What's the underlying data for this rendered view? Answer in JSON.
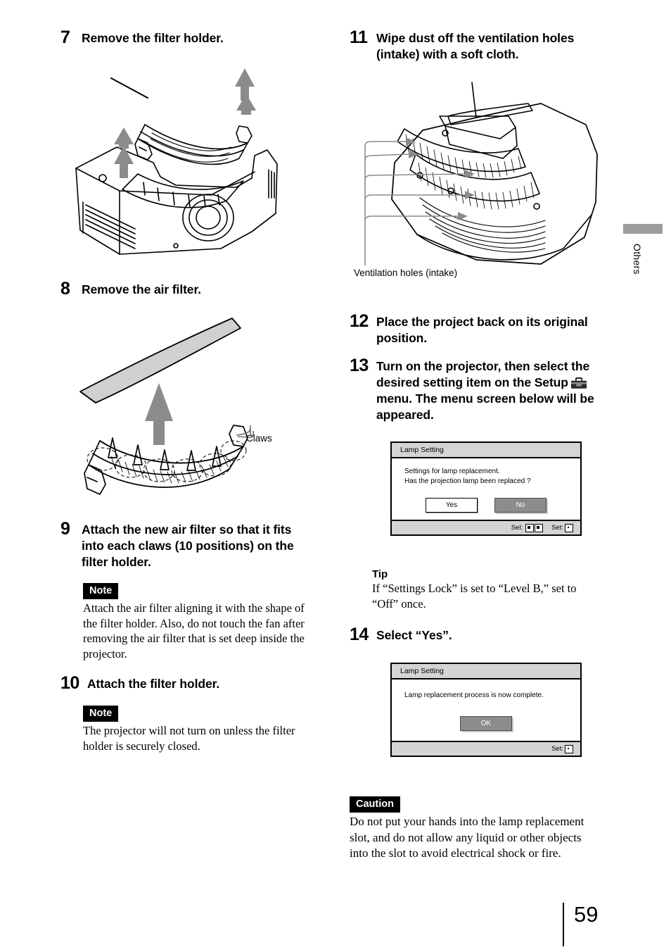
{
  "page": {
    "number": "59",
    "side_tab_label": "Others"
  },
  "left_column": {
    "step7": {
      "number": "7",
      "title": "Remove the filter holder."
    },
    "step8": {
      "number": "8",
      "title": "Remove the air filter.",
      "callout_label": "Claws"
    },
    "step9": {
      "number": "9",
      "title": "Attach the new air filter so that it fits into each claws (10 positions) on the filter holder.",
      "note_label": "Note",
      "note_text": "Attach the air filter aligning it with the shape of the filter holder. Also, do not touch the fan after removing the air filter that is set deep inside the projector."
    },
    "step10": {
      "number": "10",
      "title": "Attach the filter holder.",
      "note_label": "Note",
      "note_text": "The projector will not turn on unless the filter holder is securely closed."
    }
  },
  "right_column": {
    "step11": {
      "number": "11",
      "title": "Wipe dust off the ventilation holes (intake) with a soft cloth.",
      "callout_label": "Ventilation holes (intake)"
    },
    "step12": {
      "number": "12",
      "title": "Place the project back on its original position."
    },
    "step13": {
      "number": "13",
      "title_part1": "Turn on the projector, then select the desired setting item on the Setup",
      "icon": "toolbox-icon",
      "title_part2": "menu. The menu screen below will be appeared."
    },
    "tip": {
      "label": "Tip",
      "text": "If “Settings Lock” is set to “Level B,” set to “Off” once."
    },
    "step14": {
      "number": "14",
      "title": "Select “Yes”."
    },
    "caution": {
      "label": "Caution",
      "text": "Do not put your hands into the lamp replacement slot, and do not allow any liquid or other objects into the slot to avoid electrical shock or fire."
    }
  },
  "dialog1": {
    "title": "Lamp Setting",
    "line1": "Settings for lamp replacement.",
    "line2": "Has the projection lamp been replaced ?",
    "button_yes": "Yes",
    "button_no": "No",
    "footer_sel": "Sel:",
    "footer_set": "Set:"
  },
  "dialog2": {
    "title": "Lamp Setting",
    "line1": "Lamp replacement process is now complete.",
    "button_ok": "OK",
    "footer_set": "Set:"
  },
  "colors": {
    "osd_chrome": "#d4d4d4",
    "osd_selected": "#8c8c8c",
    "tab_bar": "#9d9d9d",
    "arrow_gray": "#8b8b8b"
  }
}
